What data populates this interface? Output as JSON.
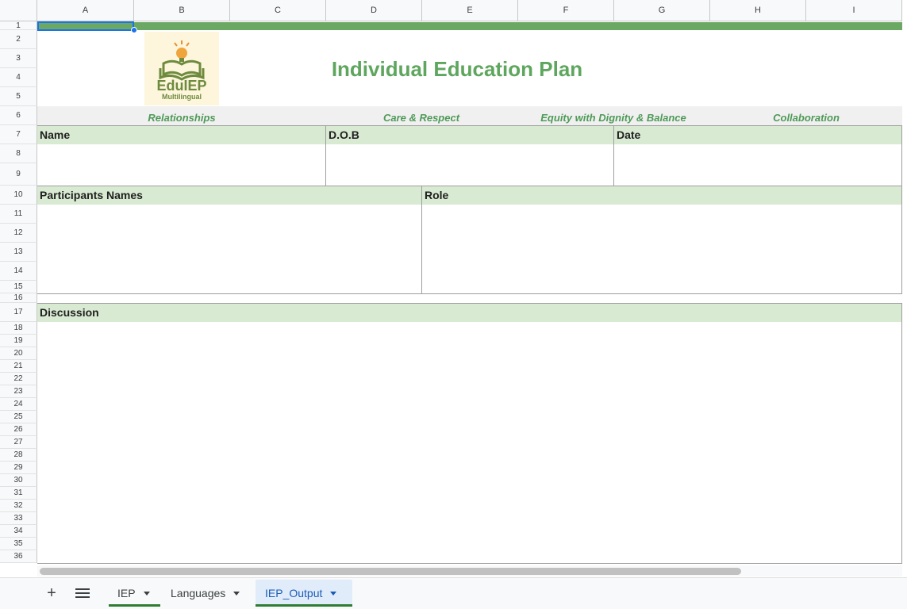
{
  "columns": [
    "A",
    "B",
    "C",
    "D",
    "E",
    "F",
    "G",
    "H",
    "I"
  ],
  "rows": [
    "1",
    "2",
    "3",
    "4",
    "5",
    "6",
    "7",
    "8",
    "9",
    "10",
    "11",
    "12",
    "13",
    "14",
    "15",
    "16",
    "17",
    "18",
    "19",
    "20",
    "21",
    "22",
    "23",
    "24",
    "25",
    "26",
    "27",
    "28",
    "29",
    "30",
    "31",
    "32",
    "33",
    "34",
    "35",
    "36"
  ],
  "logo": {
    "name": "EduIEP",
    "sub": "Multilingual"
  },
  "title": "Individual Education Plan",
  "values": [
    "Relationships",
    "Care & Respect",
    "Equity with Dignity & Balance",
    "Collaboration"
  ],
  "fields": {
    "name": "Name",
    "dob": "D.O.B",
    "date": "Date",
    "participants": "Participants Names",
    "role": "Role",
    "discussion": "Discussion"
  },
  "tabs": [
    {
      "label": "IEP",
      "active": false
    },
    {
      "label": "Languages",
      "active": false
    },
    {
      "label": "IEP_Output",
      "active": true
    }
  ],
  "colors": {
    "accent_green": "#6aa864",
    "header_fill": "#d9ead3",
    "values_text": "#4e9a57",
    "active_tab": "#1a5bb5"
  }
}
